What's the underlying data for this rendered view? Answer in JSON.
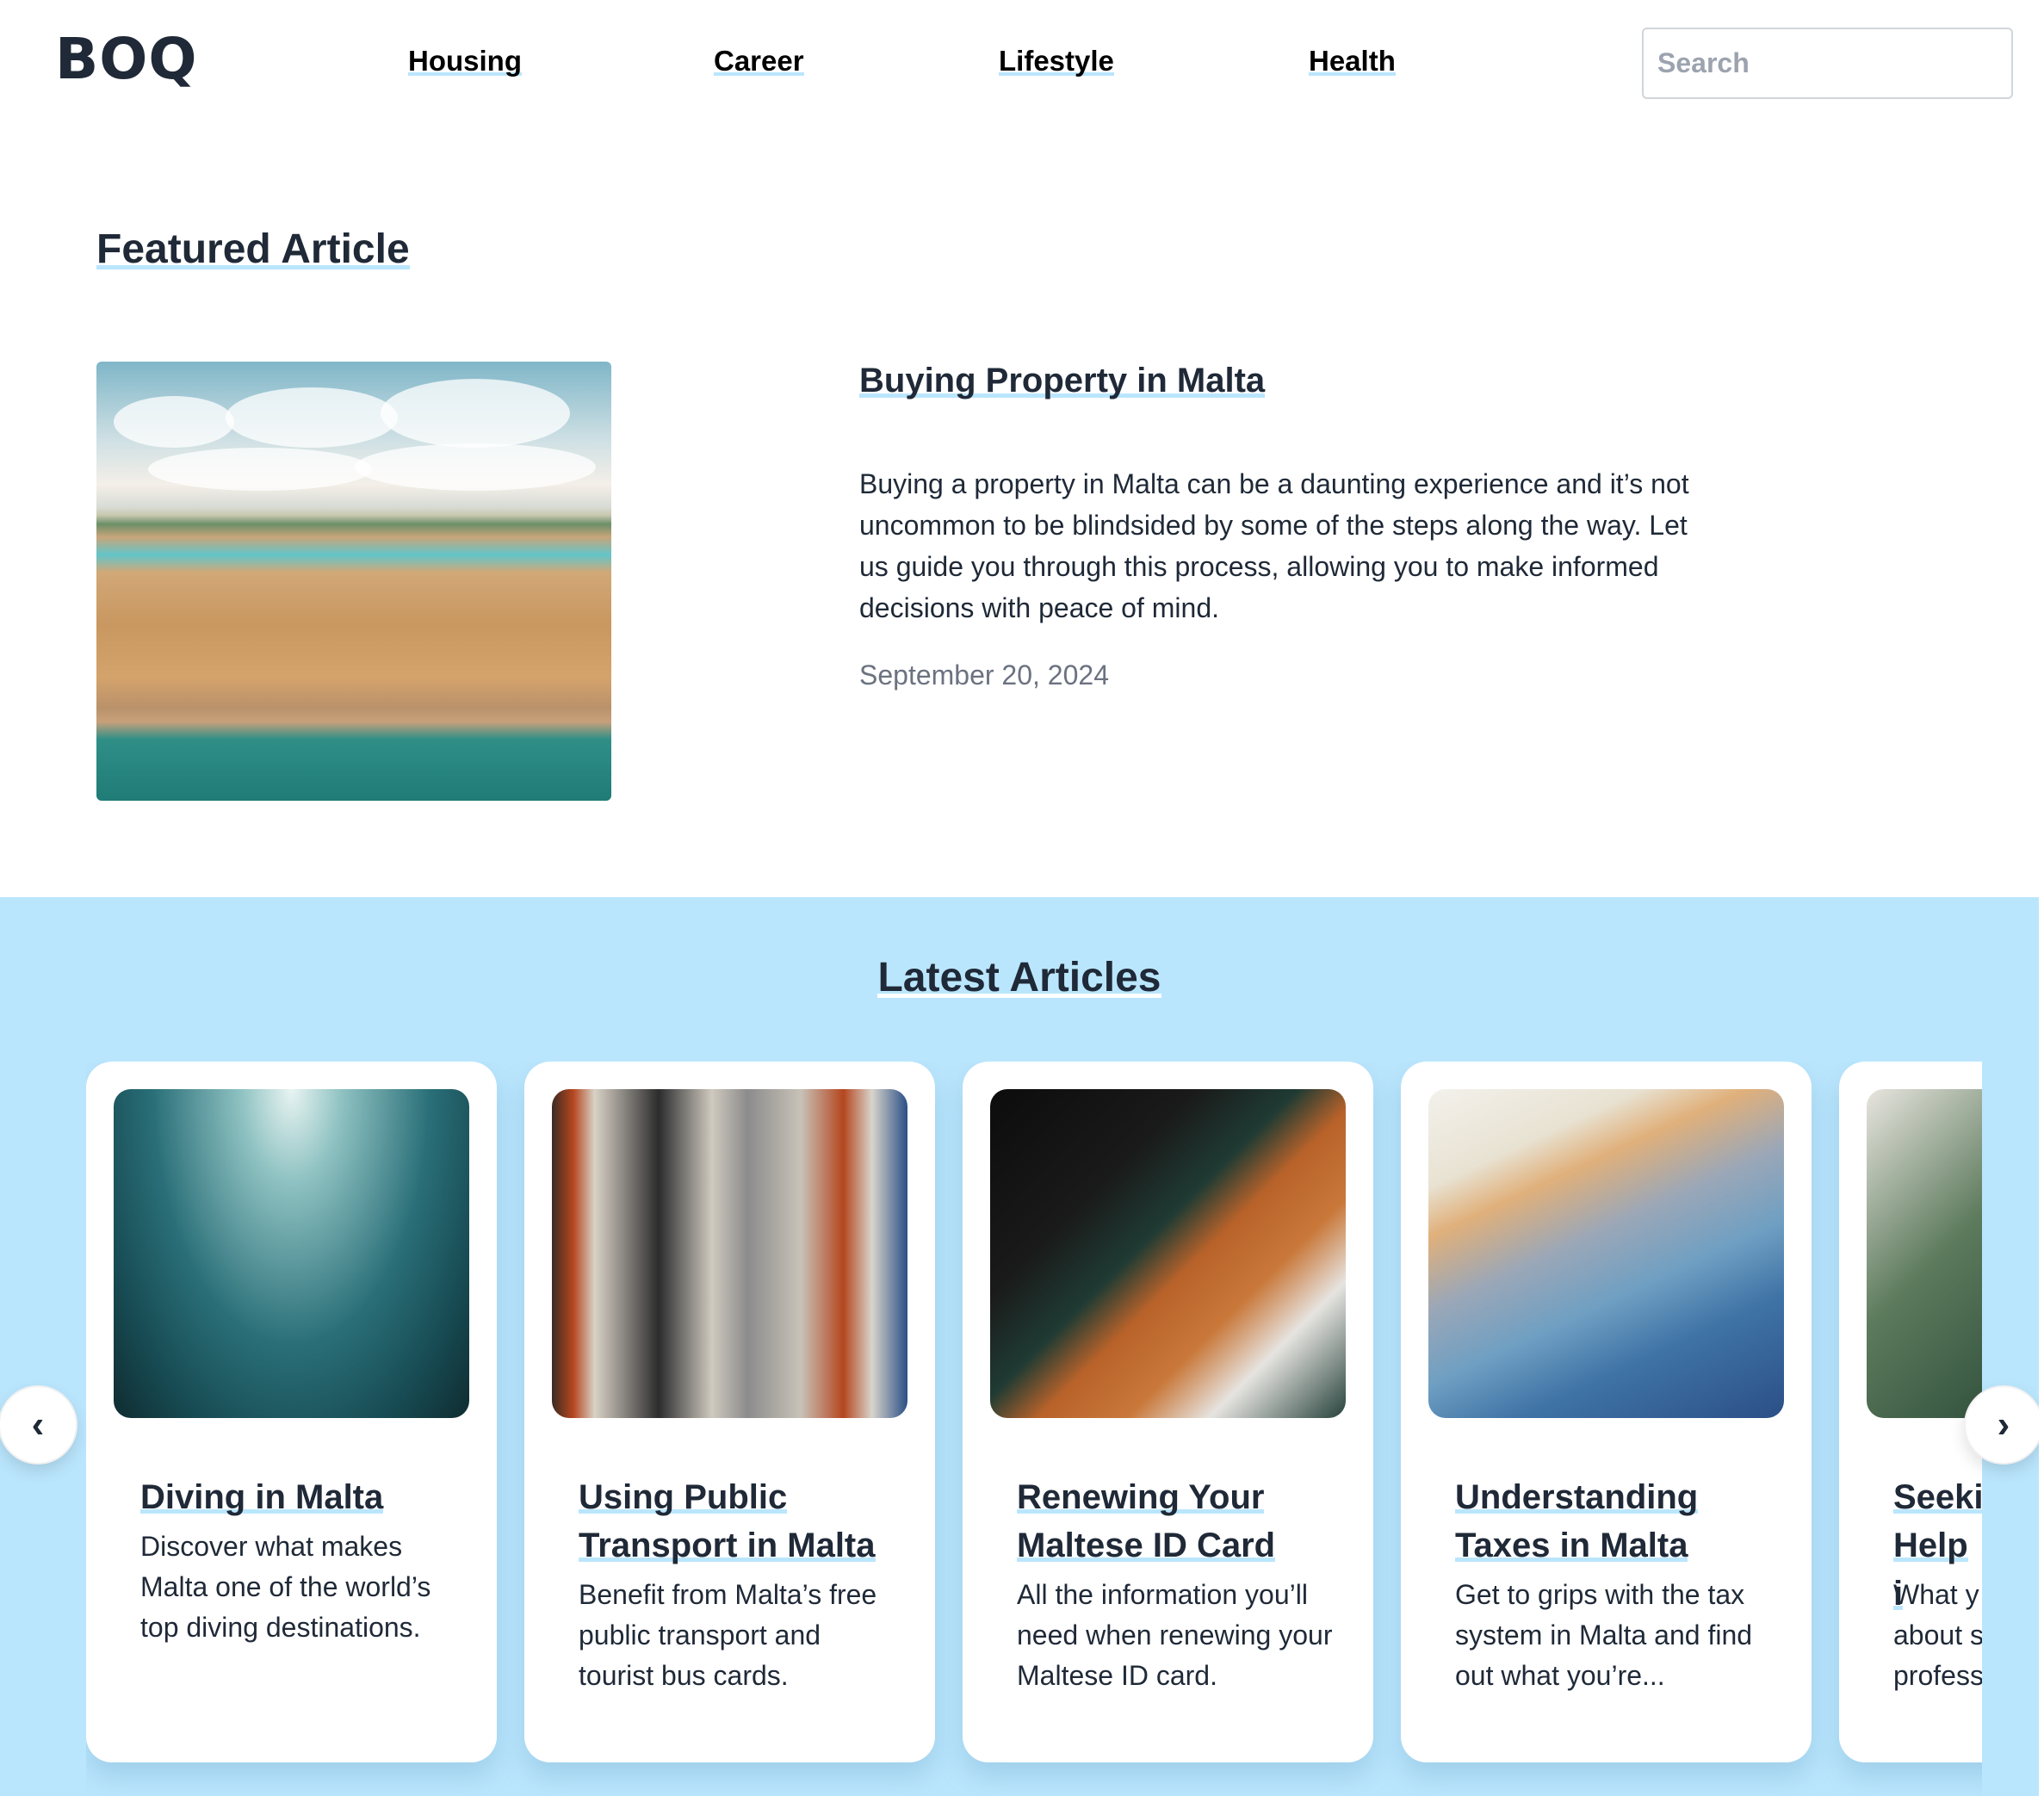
{
  "header": {
    "logo": "BOQ",
    "nav": [
      {
        "label": "Housing"
      },
      {
        "label": "Career"
      },
      {
        "label": "Lifestyle"
      },
      {
        "label": "Health"
      }
    ],
    "search": {
      "placeholder": "Search",
      "value": ""
    }
  },
  "featured": {
    "heading": "Featured Article",
    "image_alt": "Aerial view of Valletta, Malta",
    "title": "Buying Property in Malta",
    "description": "Buying a property in Malta can be a daunting experience and it’s not uncommon to be blindsided by some of the steps along the way. Let us guide you through this process, allowing you to make informed decisions with peace of mind.",
    "date": "September 20, 2024"
  },
  "latest": {
    "heading": "Latest Articles",
    "prev_icon": "‹",
    "next_icon": "›",
    "articles": [
      {
        "image": "shipwreck-underwater",
        "title": "Diving in Malta",
        "description": "Discover what makes Malta one of the world’s top diving destinations."
      },
      {
        "image": "bus-interior",
        "title": "Using Public Transport in Malta",
        "description": "Benefit from Malta’s free public transport and tourist bus cards."
      },
      {
        "image": "notebook-laptop",
        "title": "Renewing Your Maltese ID Card",
        "description": "All the information you’ll need when renewing your Maltese ID card."
      },
      {
        "image": "euro-banknotes",
        "title": "Understanding Taxes in Malta",
        "description": "Get to grips with the tax system in Malta and find out what you’re..."
      },
      {
        "image": "plant-leaves",
        "title": "Seeki Help i",
        "description": "What y about s profess"
      }
    ]
  },
  "colors": {
    "accent_underline": "#bae6fd",
    "section_background": "#bae6fd",
    "text_primary": "#1f2937",
    "text_muted": "#6b7280"
  }
}
